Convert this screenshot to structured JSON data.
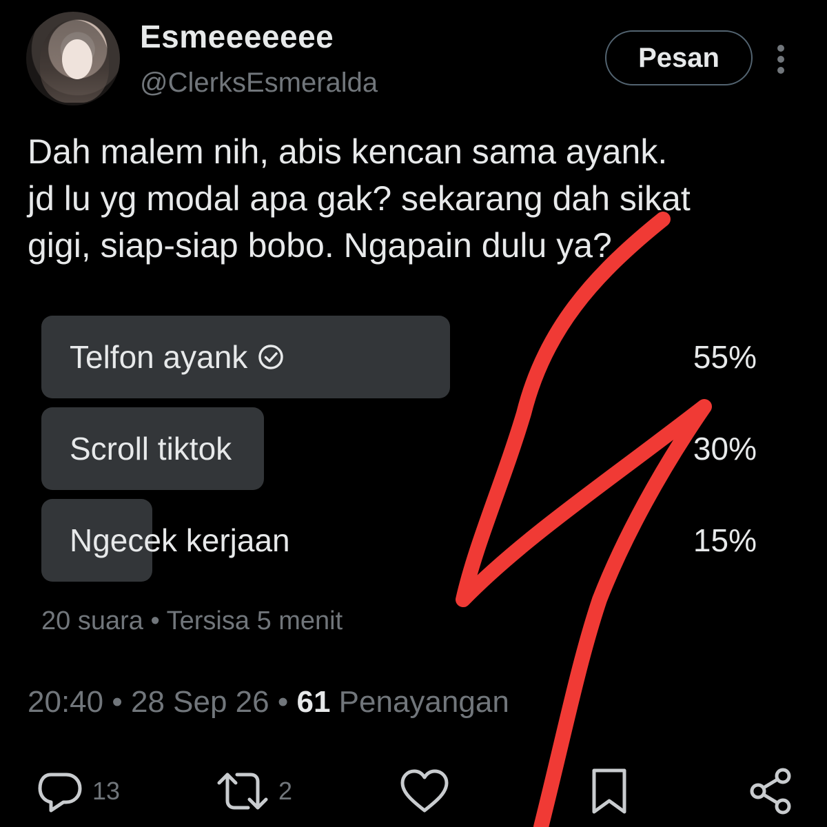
{
  "profile": {
    "display_name": "Esmeeeeeee",
    "handle": "@ClerksEsmeralda",
    "message_button": "Pesan",
    "more_icon": "more-vertical-icon"
  },
  "tweet": {
    "text": "Dah malem nih, abis kencan sama ayank.\njd lu yg modal apa gak? sekarang dah sikat\ngigi, siap-siap bobo. Ngapain dulu ya?"
  },
  "poll": {
    "options": [
      {
        "label": "Telfon ayank",
        "percent_text": "55%",
        "percent": 55,
        "selected": true
      },
      {
        "label": "Scroll tiktok",
        "percent_text": "30%",
        "percent": 30,
        "selected": false
      },
      {
        "label": "Ngecek kerjaan",
        "percent_text": "15%",
        "percent": 15,
        "selected": false
      }
    ],
    "votes": "20 suara",
    "separator": "•",
    "remaining": "Tersisa 5 menit"
  },
  "meta": {
    "time": "20:40",
    "date": "28 Sep 26",
    "separator": "•",
    "views_count": "61",
    "views_label": "Penayangan"
  },
  "actions": {
    "reply_count": "13",
    "retweet_count": "2"
  },
  "colors": {
    "background": "#000000",
    "text": "#e7e9ea",
    "muted": "#71767b",
    "poll_bar": "#333639",
    "annotation": "#f03a35"
  }
}
